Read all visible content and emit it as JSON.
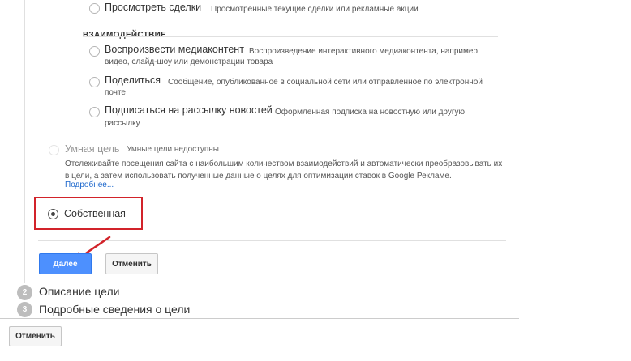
{
  "top_option": {
    "title": "Просмотреть сделки",
    "desc": "Просмотренные текущие сделки или рекламные акции"
  },
  "engagement": {
    "header": "ВЗАИМОДЕЙСТВИЕ",
    "options": [
      {
        "title": "Воспроизвести медиаконтент",
        "desc": "Воспроизведение интерактивного медиаконтента, например",
        "desc_cont": "видео, слайд-шоу или демонстрации товара"
      },
      {
        "title": "Поделиться",
        "desc": "Сообщение, опубликованное в социальной сети или отправленное по электронной",
        "desc_cont": "почте"
      },
      {
        "title": "Подписаться на рассылку новостей",
        "desc": "Оформленная подписка на новостную или другую",
        "desc_cont": "рассылку"
      }
    ]
  },
  "smart_goal": {
    "title": "Умная цель",
    "subtitle": "Умные цели недоступны",
    "desc": "Отслеживайте посещения сайта с наибольшим количеством взаимодействий и автоматически преобразовывать их в цели, а затем использовать полученные данные о целях для оптимизации ставок в Google Рекламе.",
    "more_link": "Подробнее..."
  },
  "custom_goal": {
    "label": "Собственная",
    "selected": true
  },
  "actions": {
    "next_label": "Далее",
    "cancel_label": "Отменить"
  },
  "steps": [
    {
      "number": "2",
      "label": "Описание цели"
    },
    {
      "number": "3",
      "label": "Подробные сведения о цели"
    }
  ],
  "footer": {
    "cancel_label": "Отменить"
  },
  "colors": {
    "primary": "#4d90fe",
    "highlight": "#d2232a",
    "link": "#1a66cc"
  }
}
